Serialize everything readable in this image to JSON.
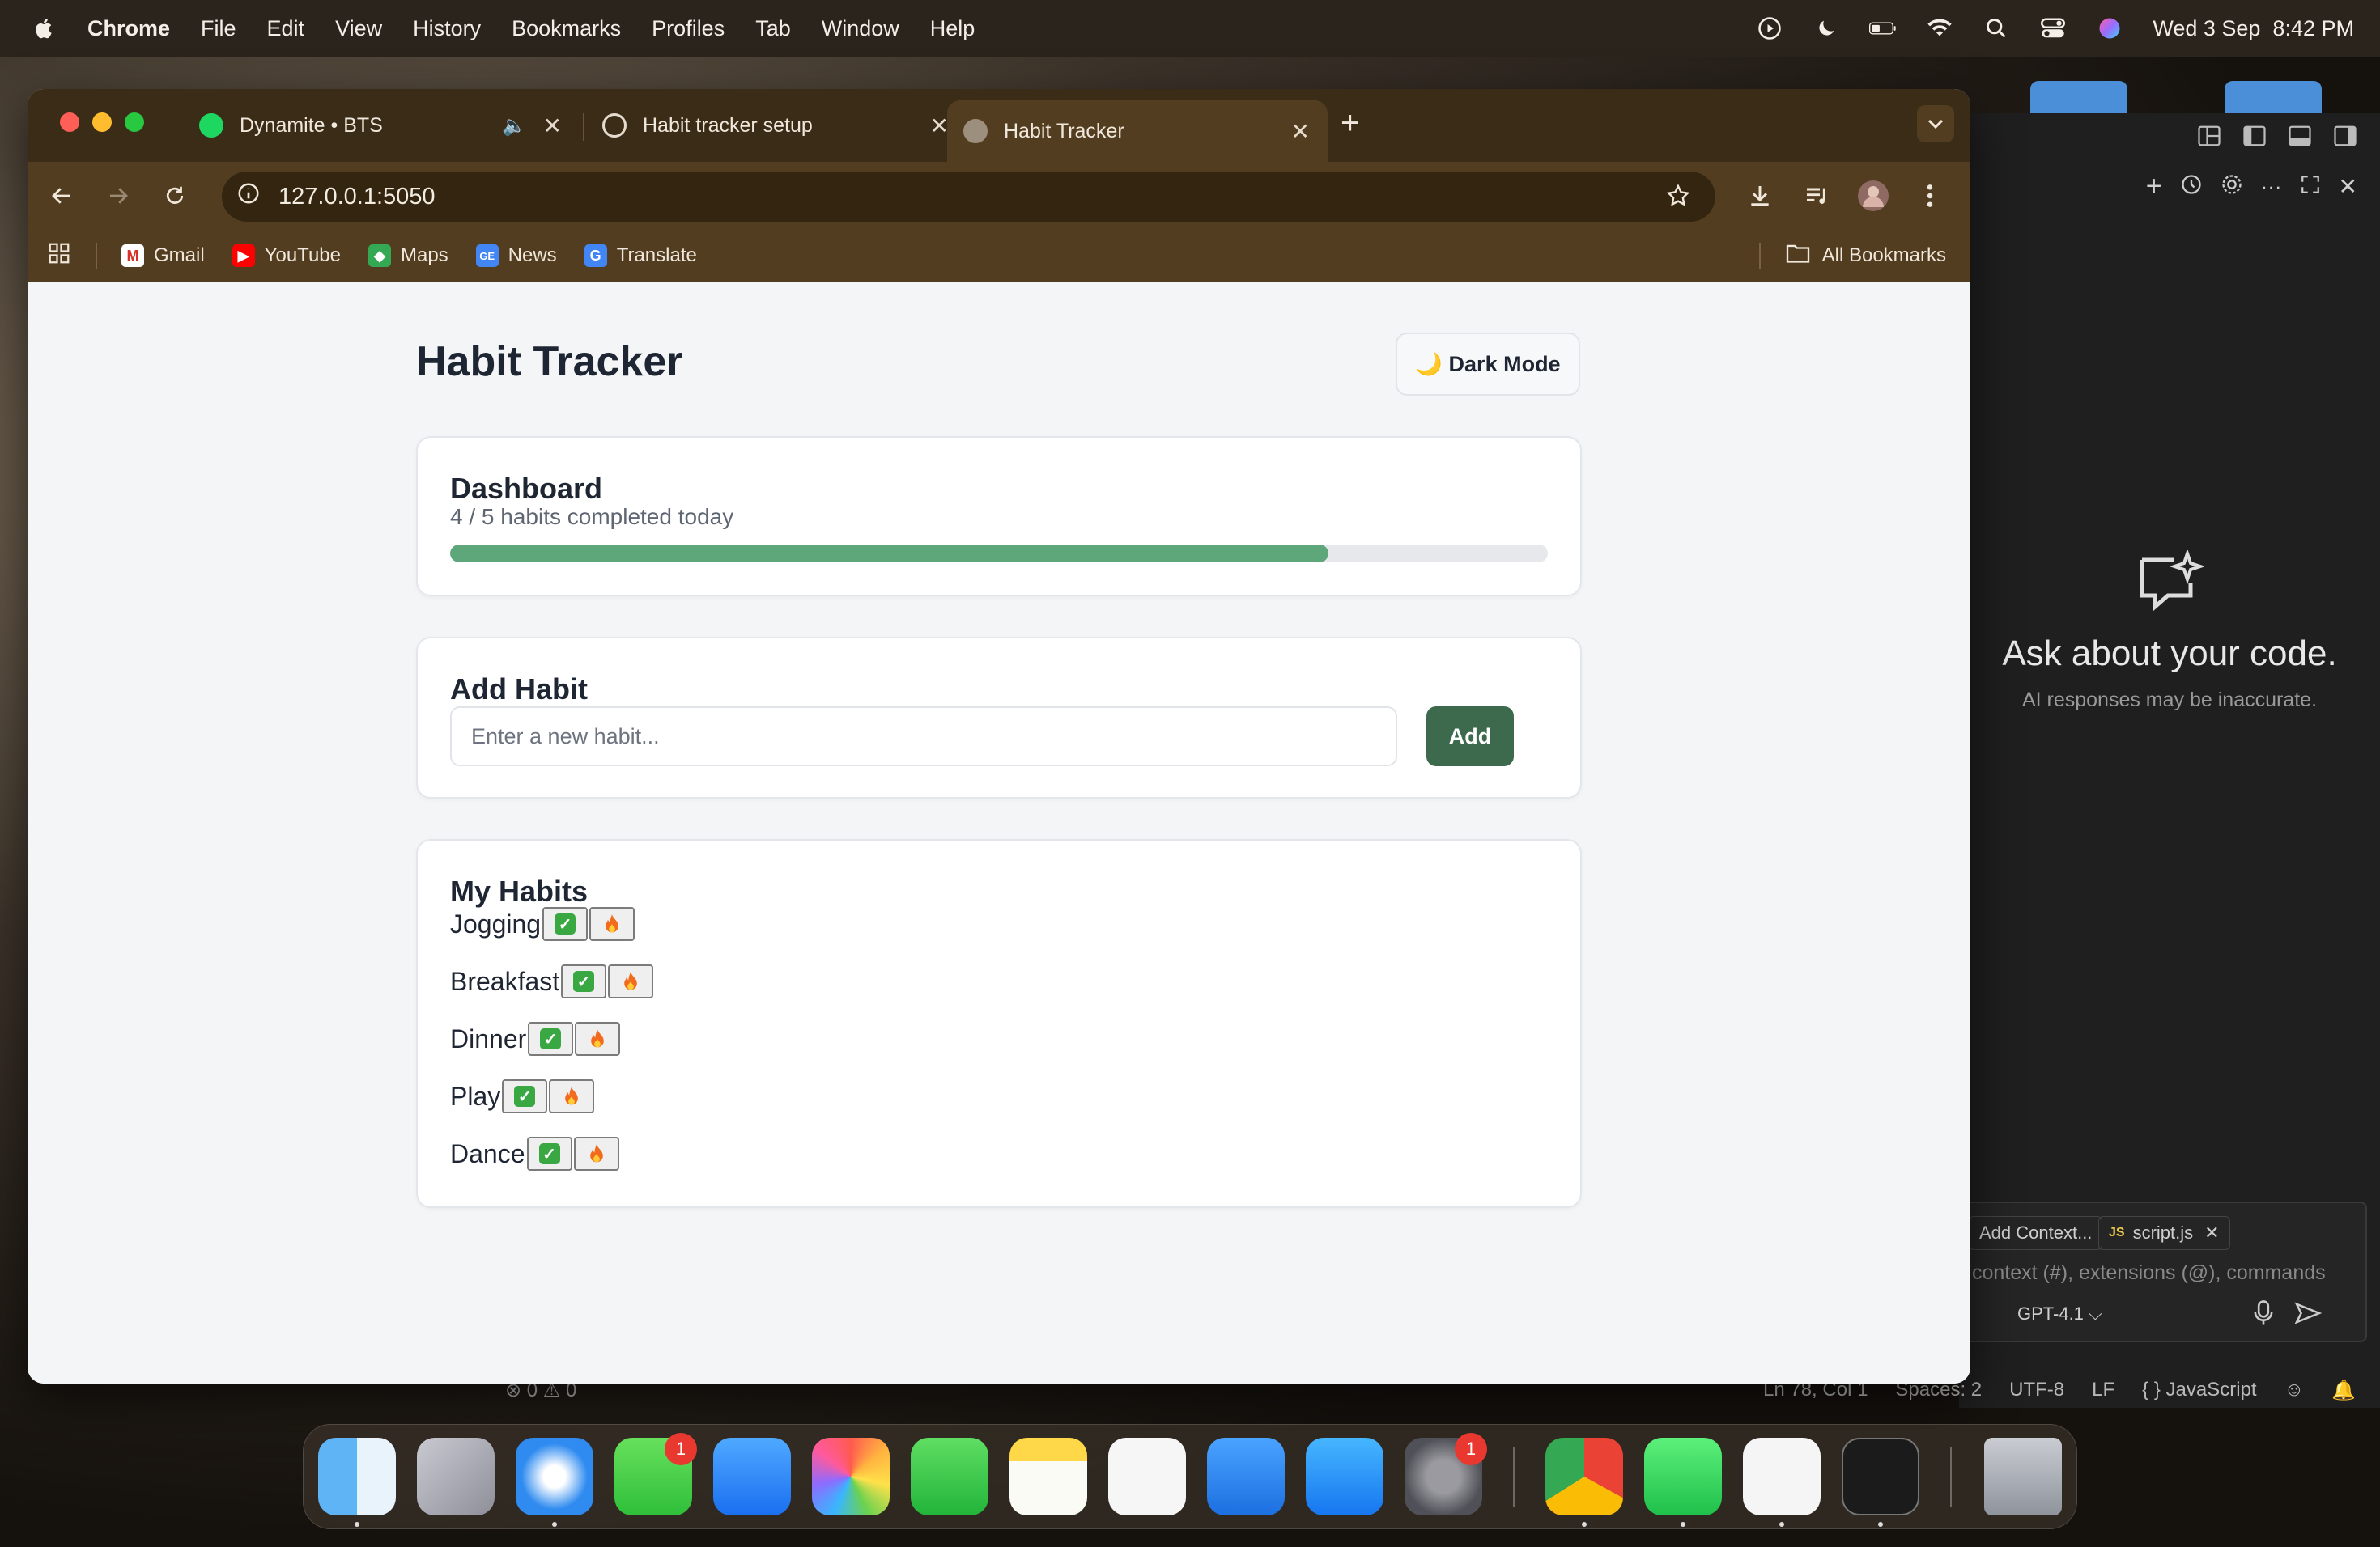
{
  "menubar": {
    "app": "Chrome",
    "items": [
      "File",
      "Edit",
      "View",
      "History",
      "Bookmarks",
      "Profiles",
      "Tab",
      "Window",
      "Help"
    ],
    "datetime": "Wed 3 Sep  8:42 PM"
  },
  "browser": {
    "tabs": [
      {
        "title": "Dynamite • BTS"
      },
      {
        "title": "Habit tracker setup"
      },
      {
        "title": "Habit Tracker"
      }
    ],
    "url": "127.0.0.1:5050",
    "bookmarks": [
      "Gmail",
      "YouTube",
      "Maps",
      "News",
      "Translate"
    ],
    "all_bookmarks": "All Bookmarks"
  },
  "app": {
    "title": "Habit Tracker",
    "dark_mode_label": "🌙 Dark Mode",
    "dashboard": {
      "title": "Dashboard",
      "summary": "4 / 5 habits completed today",
      "progress": 0.8
    },
    "add_habit": {
      "title": "Add Habit",
      "placeholder": "Enter a new habit...",
      "button": "Add"
    },
    "my_habits": {
      "title": "My Habits",
      "items": [
        {
          "name": "Jogging"
        },
        {
          "name": "Breakfast"
        },
        {
          "name": "Dinner"
        },
        {
          "name": "Play"
        },
        {
          "name": "Dance"
        }
      ]
    }
  },
  "vscode": {
    "chat_heading": "Ask about your code.",
    "chat_warning": "AI responses may be inaccurate.",
    "add_context": "Add Context...",
    "file_chip": "script.js",
    "file_chip_badge": "JS",
    "input_placeholder": "context (#), extensions (@), commands",
    "model": "GPT-4.1",
    "status": {
      "problems": "⊗ 0 ⚠ 0",
      "position": "Ln 78, Col 1",
      "spaces": "Spaces: 2",
      "encoding": "UTF-8",
      "eol": "LF",
      "language": "{ } JavaScript"
    }
  },
  "dock": {
    "badges": {
      "messages": "1",
      "settings": "1"
    }
  },
  "colors": {
    "accent_green": "#3d6a4c",
    "progress_green": "#5ea77a",
    "chrome_frame": "#533d20"
  }
}
